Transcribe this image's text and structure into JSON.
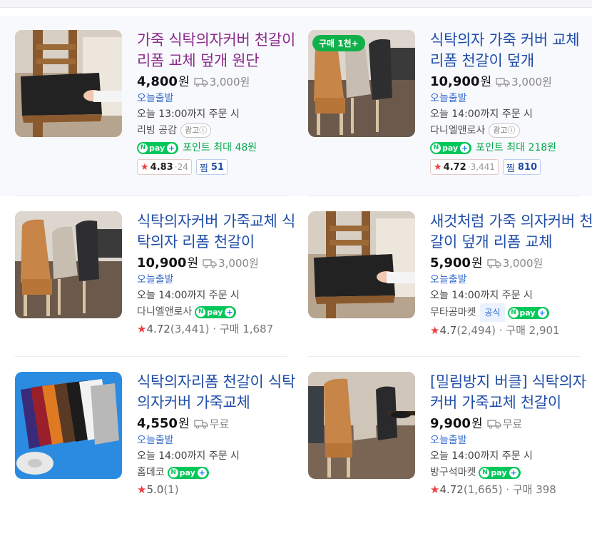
{
  "colors": {
    "link": "#1f4da8",
    "visited": "#8a2b8a",
    "today": "#3a6fd1",
    "npay": "#03c75a",
    "star": "#f03e3e",
    "badge": "#10b04a"
  },
  "products": [
    {
      "title": "가죽 식탁의자커버 천갈이 리폼 교체 덮개 원단",
      "price": "4,800",
      "won": "원",
      "shipping": "3,000원",
      "delivery": "오늘출발",
      "order_cutoff": "오늘 13:00까지 주문 시",
      "seller": "리빙 공감",
      "ad_label": "광고ⓘ",
      "npay_label": "pay",
      "point_text": "포인트 최대 48원",
      "rating": "4.83",
      "review_count": "24",
      "zzim_label": "찜",
      "zzim_count": "51"
    },
    {
      "title": "식탁의자 가죽 커버 교체 리폼 천갈이 덮개",
      "price": "10,900",
      "won": "원",
      "shipping": "3,000원",
      "delivery": "오늘출발",
      "order_cutoff": "오늘 14:00까지 주문 시",
      "seller": "다니엘앤로사",
      "ad_label": "광고ⓘ",
      "badge": "구매 1천+",
      "npay_label": "pay",
      "point_text": "포인트 최대 218원",
      "rating": "4.72",
      "review_count": "3,441",
      "zzim_label": "찜",
      "zzim_count": "810"
    },
    {
      "title": "식탁의자커버 가죽교체 식탁의자 리폼 천갈이",
      "price": "10,900",
      "won": "원",
      "shipping": "3,000원",
      "delivery": "오늘출발",
      "order_cutoff": "오늘 14:00까지 주문 시",
      "seller": "다니엘앤로사",
      "npay_label": "pay",
      "rating": "4.72",
      "review_count": "(3,441)",
      "purchase": "구매 1,687"
    },
    {
      "title": "새것처럼 가죽 의자커버 천갈이 덮개 리폼 교체",
      "price": "5,900",
      "won": "원",
      "shipping": "3,000원",
      "delivery": "오늘출발",
      "order_cutoff": "오늘 14:00까지 주문 시",
      "seller": "무타공마켓",
      "official": "공식",
      "npay_label": "pay",
      "rating": "4.7",
      "review_count": "(2,494)",
      "purchase": "구매 2,901"
    },
    {
      "title": "식탁의자리폼 천갈이 식탁의자커버 가죽교체",
      "price": "4,550",
      "won": "원",
      "shipping": "무료",
      "delivery": "오늘출발",
      "order_cutoff": "오늘 14:00까지 주문 시",
      "seller": "홈데코",
      "npay_label": "pay",
      "rating": "5.0",
      "review_count": "(1)"
    },
    {
      "title": "[밀림방지 버클] 식탁의자커버 가죽교체 천갈이",
      "price": "9,900",
      "won": "원",
      "shipping": "무료",
      "delivery": "오늘출발",
      "order_cutoff": "오늘 14:00까지 주문 시",
      "seller": "방구석마켓",
      "npay_label": "pay",
      "rating": "4.72",
      "review_count": "(1,665)",
      "purchase": "구매 398"
    }
  ]
}
